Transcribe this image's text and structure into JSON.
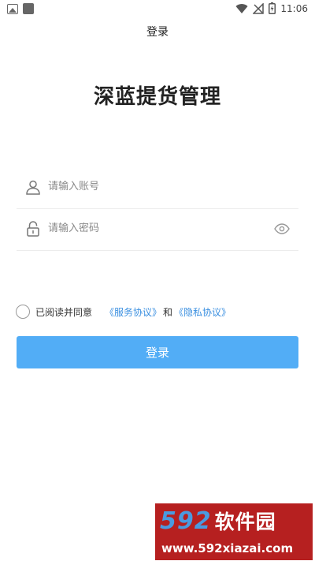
{
  "status_bar": {
    "time": "11:06",
    "icons": [
      "image-icon",
      "square-icon",
      "wifi-icon",
      "signal-off-icon",
      "battery-charging-icon"
    ]
  },
  "header": {
    "title": "登录"
  },
  "app": {
    "name": "深蓝提货管理"
  },
  "login_form": {
    "account_placeholder": "请输入账号",
    "password_placeholder": "请输入密码",
    "agree_text": "已阅读并同意",
    "service_agreement": "《服务协议》",
    "and_text": "和",
    "privacy_agreement": "《隐私协议》",
    "submit_label": "登录"
  },
  "watermark": {
    "brand_number": "592",
    "brand_text": "软件园",
    "url": "www.592xiazai.com"
  },
  "colors": {
    "primary": "#52adf6",
    "link": "#3a8fe0",
    "watermark_bg": "#b62020"
  }
}
